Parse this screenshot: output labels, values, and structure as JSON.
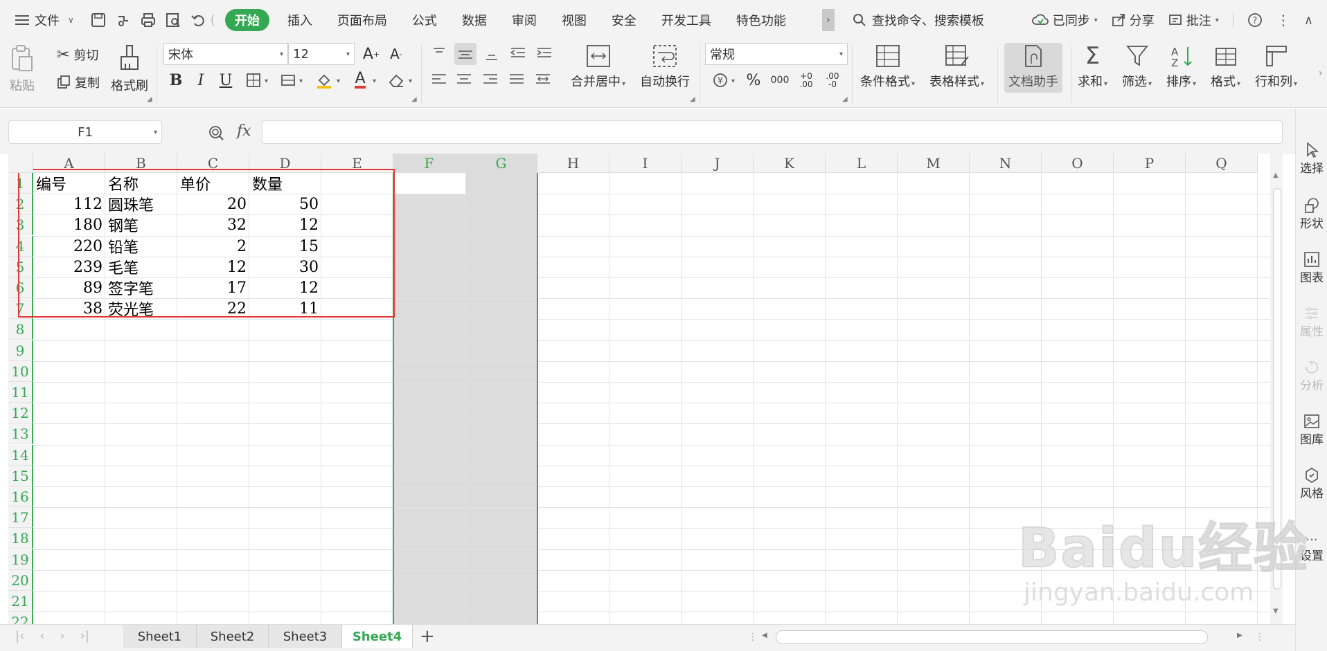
{
  "menu": {
    "file": "文件",
    "tabs": [
      "开始",
      "插入",
      "页面布局",
      "公式",
      "数据",
      "审阅",
      "视图",
      "安全",
      "开发工具",
      "特色功能"
    ],
    "active_tab": "开始",
    "search": "查找命令、搜索模板",
    "sync": "已同步",
    "share": "分享",
    "comment": "批注"
  },
  "ribbon": {
    "paste": "粘贴",
    "cut": "剪切",
    "copy": "复制",
    "format_painter": "格式刷",
    "font_name": "宋体",
    "font_size": "12",
    "bold": "B",
    "italic": "I",
    "underline": "U",
    "merge_center": "合并居中",
    "wrap_text": "自动换行",
    "number_format": "常规",
    "cond_format": "条件格式",
    "table_style": "表格样式",
    "doc_assistant": "文档助手",
    "sum": "求和",
    "filter": "筛选",
    "sort": "排序",
    "format": "格式",
    "row_col": "行和列"
  },
  "formula_bar": {
    "name_box": "F1",
    "fx": "fx",
    "value": ""
  },
  "grid": {
    "columns": [
      "A",
      "B",
      "C",
      "D",
      "E",
      "F",
      "G",
      "H",
      "I",
      "J",
      "K",
      "L",
      "M",
      "N",
      "O",
      "P",
      "Q"
    ],
    "rows": [
      "1",
      "2",
      "3",
      "4",
      "5",
      "6",
      "7",
      "8",
      "9",
      "10",
      "11",
      "12",
      "13",
      "14",
      "15",
      "16",
      "17",
      "18",
      "19",
      "20",
      "21",
      "22"
    ],
    "headers": [
      "编号",
      "名称",
      "单价",
      "数量"
    ],
    "data": [
      [
        "112",
        "圆珠笔",
        "20",
        "50"
      ],
      [
        "180",
        "钢笔",
        "32",
        "12"
      ],
      [
        "220",
        "铅笔",
        "2",
        "15"
      ],
      [
        "239",
        "毛笔",
        "12",
        "30"
      ],
      [
        "89",
        "签字笔",
        "17",
        "12"
      ],
      [
        "38",
        "荧光笔",
        "22",
        "11"
      ]
    ]
  },
  "right_panel": [
    "选择",
    "形状",
    "图表",
    "属性",
    "分析",
    "图库",
    "风格",
    "设置"
  ],
  "sheets": [
    "Sheet1",
    "Sheet2",
    "Sheet3",
    "Sheet4"
  ],
  "active_sheet": "Sheet4",
  "watermark": {
    "main": "Baidu经验",
    "sub": "jingyan.baidu.com"
  },
  "colors": {
    "accent": "#34a853",
    "highlight": "#e53935"
  }
}
